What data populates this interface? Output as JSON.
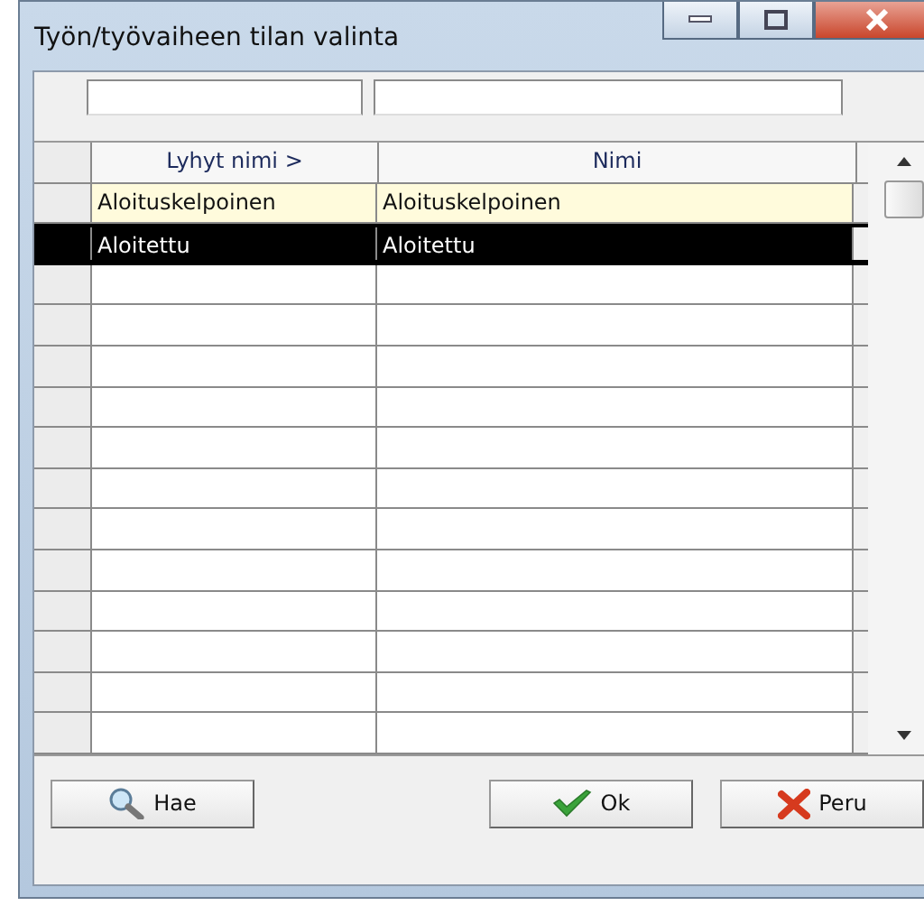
{
  "window": {
    "title": "Työn/työvaiheen tilan valinta"
  },
  "table": {
    "columns": [
      "Lyhyt nimi  >",
      "Nimi"
    ],
    "rows": [
      {
        "cells": [
          "Aloituskelpoinen",
          "Aloituskelpoinen"
        ],
        "selected": false,
        "highlighted": true
      },
      {
        "cells": [
          "Aloitettu",
          "Aloitettu"
        ],
        "selected": true,
        "highlighted": false
      }
    ]
  },
  "buttons": [
    {
      "kind": "search",
      "label": "Hae"
    },
    {
      "kind": "ok",
      "label": "Ok"
    },
    {
      "kind": "cancel",
      "label": "Peru"
    }
  ]
}
